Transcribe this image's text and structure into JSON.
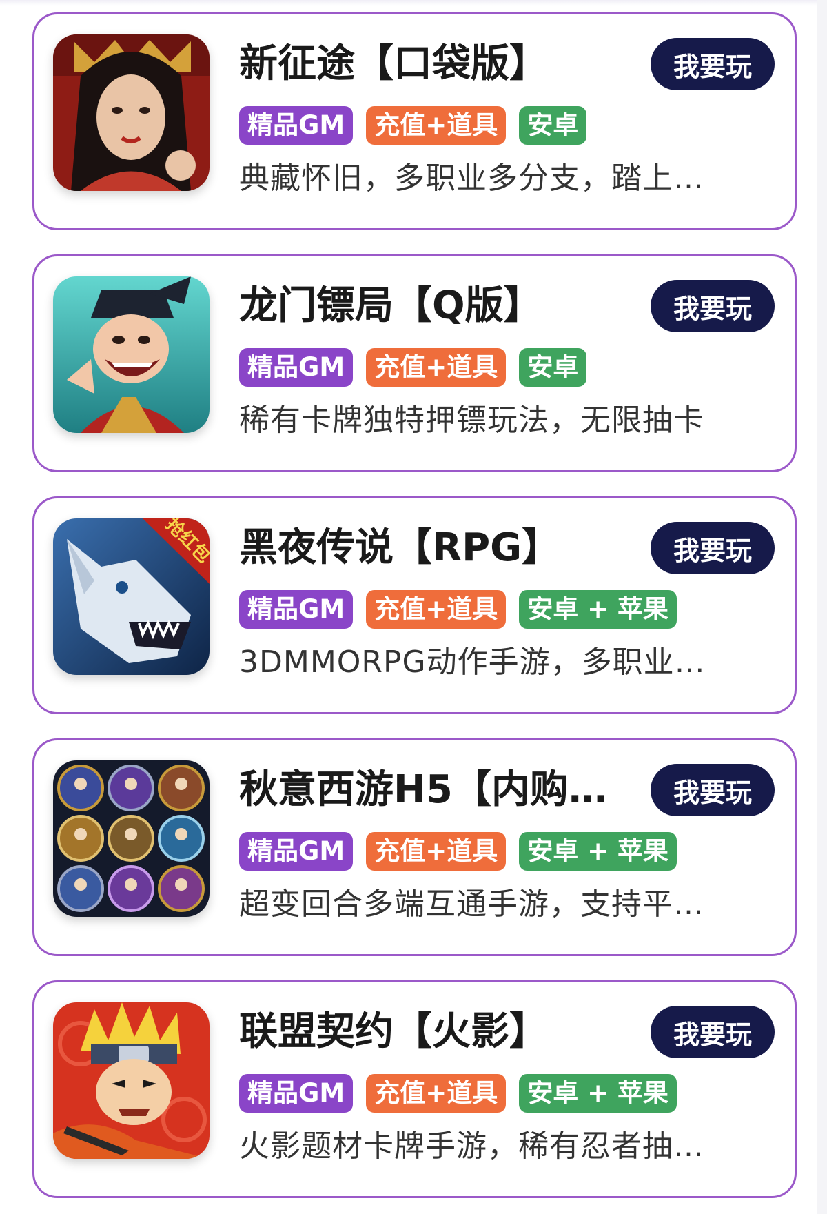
{
  "games": [
    {
      "title": "新征途【口袋版】",
      "button": "我要玩",
      "tags": [
        "精品GM",
        "充值+道具",
        "安卓"
      ],
      "description": "典藏怀旧，多职业多分支，踏上…",
      "icon": "queen-portrait-icon",
      "icon_colors": [
        "#b3261e",
        "#e8c9a0"
      ]
    },
    {
      "title": "龙门镖局【Q版】",
      "button": "我要玩",
      "tags": [
        "精品GM",
        "充值+道具",
        "安卓"
      ],
      "description": "稀有卡牌独特押镖玩法，无限抽卡",
      "icon": "laughing-official-icon",
      "icon_colors": [
        "#3ec0b8",
        "#c0392b"
      ]
    },
    {
      "title": "黑夜传说【RPG】",
      "button": "我要玩",
      "tags": [
        "精品GM",
        "充值+道具",
        "安卓 + 苹果"
      ],
      "description": "3DMMORPG动作手游，多职业…",
      "icon": "wolf-icon",
      "icon_colors": [
        "#1b4f8a",
        "#dfe8f2"
      ],
      "icon_ribbon": "抢红包"
    },
    {
      "title": "秋意西游H5【内购…",
      "button": "我要玩",
      "tags": [
        "精品GM",
        "充值+道具",
        "安卓 + 苹果"
      ],
      "description": "超变回合多端互通手游，支持平…",
      "icon": "character-grid-icon",
      "icon_colors": [
        "#141a2b",
        "#c79a3a"
      ]
    },
    {
      "title": "联盟契约【火影】",
      "button": "我要玩",
      "tags": [
        "精品GM",
        "充值+道具",
        "安卓 + 苹果"
      ],
      "description": "火影题材卡牌手游，稀有忍者抽…",
      "icon": "ninja-icon",
      "icon_colors": [
        "#d6331f",
        "#f5d23c"
      ]
    }
  ]
}
